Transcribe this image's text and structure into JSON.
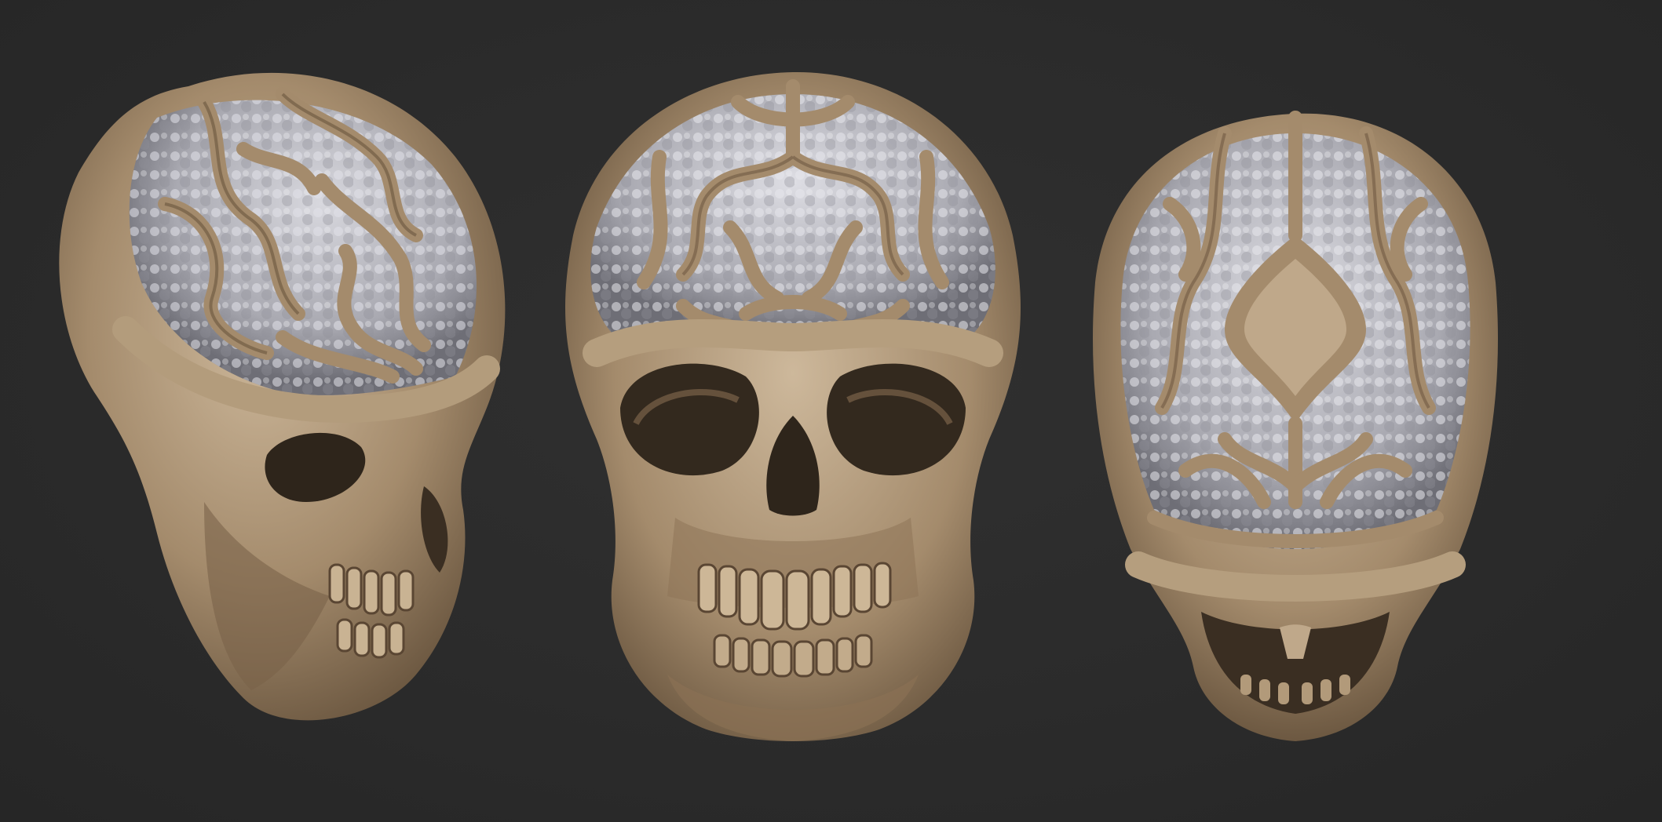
{
  "scene": {
    "background_color": "#2b2b2b",
    "material_color": "#a48b6c",
    "material_highlight": "#cdb89b",
    "material_shadow": "#5f4c37",
    "cranium_fill_color": "#b9b9bf",
    "views": [
      {
        "name": "three-quarter-left",
        "subject": "ornate-skull"
      },
      {
        "name": "front",
        "subject": "ornate-skull"
      },
      {
        "name": "top",
        "subject": "ornate-skull"
      }
    ]
  }
}
